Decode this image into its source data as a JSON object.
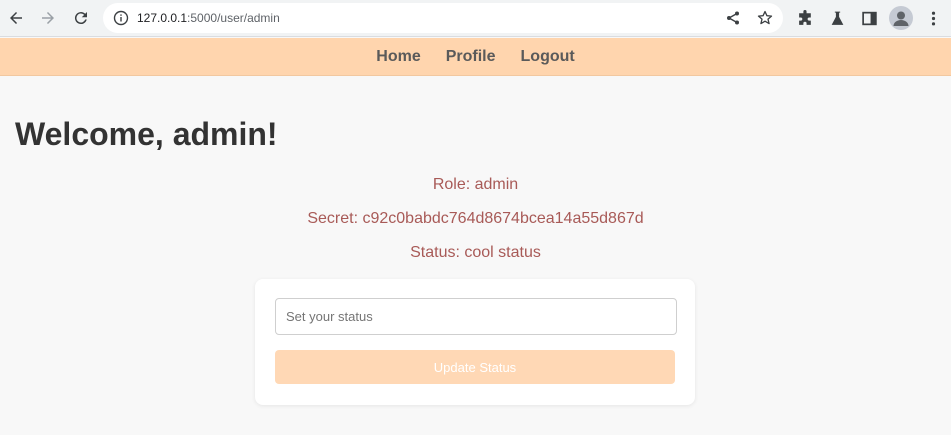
{
  "browser": {
    "url_host": "127.0.0.1",
    "url_path": ":5000/user/admin"
  },
  "nav": {
    "items": [
      {
        "label": "Home"
      },
      {
        "label": "Profile"
      },
      {
        "label": "Logout"
      }
    ]
  },
  "main": {
    "welcome": "Welcome, admin!",
    "role": "Role: admin",
    "secret": "Secret: c92c0babdc764d8674bcea14a55d867d",
    "status": "Status: cool status"
  },
  "form": {
    "input_placeholder": "Set your status",
    "input_value": "",
    "button_label": "Update Status"
  },
  "colors": {
    "nav_bg": "#ffd5ae",
    "info_text": "#a85a57",
    "button_bg": "#ffd8b5",
    "page_bg": "#f8f8f8"
  }
}
